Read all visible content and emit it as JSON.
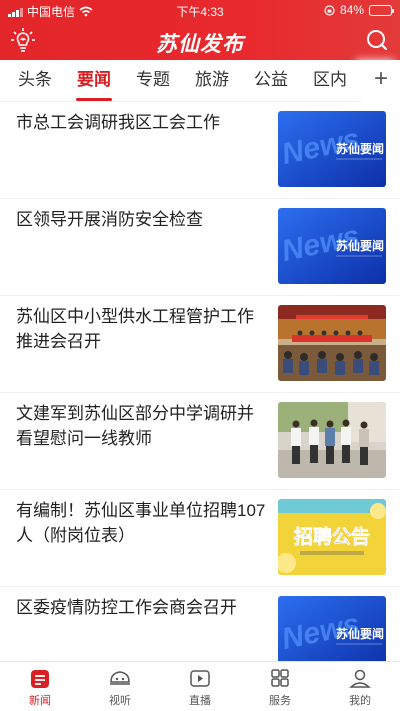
{
  "status_bar": {
    "carrier": "中国电信",
    "time": "下午4:33",
    "battery": "84%",
    "battery_level": 0.84
  },
  "header": {
    "title": "苏仙发布",
    "left_icon": "lightbulb-icon",
    "right_icon": "search-icon"
  },
  "tabs": [
    {
      "label": "头条",
      "active": false
    },
    {
      "label": "要闻",
      "active": true
    },
    {
      "label": "专题",
      "active": false
    },
    {
      "label": "旅游",
      "active": false
    },
    {
      "label": "公益",
      "active": false
    },
    {
      "label": "区内",
      "active": false
    }
  ],
  "tabs_more": "+",
  "news": [
    {
      "title": "市总工会调研我区工会工作",
      "thumb": "news-banner",
      "thumb_text": "苏仙要闻",
      "thumb_sub": "News"
    },
    {
      "title": "区领导开展消防安全检查",
      "thumb": "news-banner",
      "thumb_text": "苏仙要闻",
      "thumb_sub": "News"
    },
    {
      "title": "苏仙区中小型供水工程管护工作推进会召开",
      "thumb": "meeting-photo"
    },
    {
      "title": "文建军到苏仙区部分中学调研并看望慰问一线教师",
      "thumb": "visit-photo"
    },
    {
      "title": "有编制！苏仙区事业单位招聘107人（附岗位表）",
      "thumb": "recruit-banner",
      "thumb_text": "招聘公告"
    },
    {
      "title": "区委疫情防控工作会商会召开",
      "thumb": "news-banner",
      "thumb_text": "苏仙要闻",
      "thumb_sub": "News"
    }
  ],
  "bottom_nav": [
    {
      "label": "新闻",
      "icon": "news-icon",
      "active": true
    },
    {
      "label": "视听",
      "icon": "video-icon",
      "active": false
    },
    {
      "label": "直播",
      "icon": "live-icon",
      "active": false
    },
    {
      "label": "服务",
      "icon": "grid-icon",
      "active": false
    },
    {
      "label": "我的",
      "icon": "user-icon",
      "active": false
    }
  ],
  "colors": {
    "brand_red": "#e3262a",
    "active_red": "#d62024",
    "news_blue": "#1d4fd6",
    "recruit_yellow": "#f3d33a"
  }
}
